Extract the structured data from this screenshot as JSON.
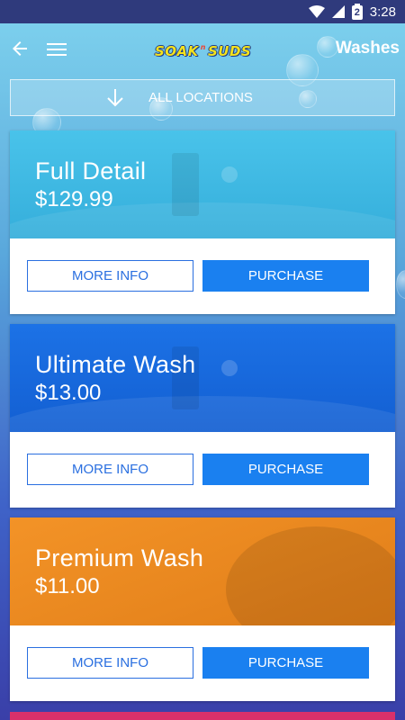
{
  "status_bar": {
    "time": "3:28"
  },
  "app_bar": {
    "title": "Washes",
    "logo": {
      "left": "SOAK",
      "mid": "n",
      "right": "SUDS"
    }
  },
  "location_filter": {
    "label": "ALL LOCATIONS"
  },
  "colors": {
    "full_detail": "#3fb7e0",
    "ultimate_wash": "#1669e0",
    "premium_wash": "#f08a1e",
    "next_card": "#d8306a",
    "purchase_button": "#1a80f0"
  },
  "washes": [
    {
      "name": "Full Detail",
      "price": "$129.99",
      "more_info": "MORE INFO",
      "purchase": "PURCHASE"
    },
    {
      "name": "Ultimate Wash",
      "price": "$13.00",
      "more_info": "MORE INFO",
      "purchase": "PURCHASE"
    },
    {
      "name": "Premium Wash",
      "price": "$11.00",
      "more_info": "MORE INFO",
      "purchase": "PURCHASE"
    }
  ]
}
